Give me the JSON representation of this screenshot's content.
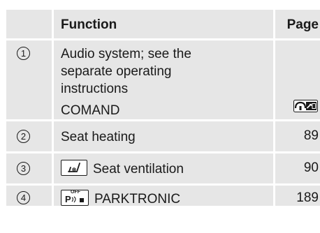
{
  "table": {
    "header": {
      "function_label": "Function",
      "page_label": "Page"
    },
    "rows": [
      {
        "number": "1",
        "lines": [
          "Audio system; see the",
          "separate operating",
          "instructions"
        ],
        "sub_label": "COMAND",
        "page": "",
        "page_icon": "comand-steering-icon"
      },
      {
        "number": "2",
        "label": "Seat heating",
        "page": "89"
      },
      {
        "number": "3",
        "label": "Seat ventilation",
        "page": "90",
        "icon": "seat-ventilation-icon"
      },
      {
        "number": "4",
        "label": "PARKTRONIC",
        "page": "189",
        "icon": "parktronic-off-icon",
        "icon_text": [
          "OFF",
          "P"
        ]
      }
    ]
  }
}
